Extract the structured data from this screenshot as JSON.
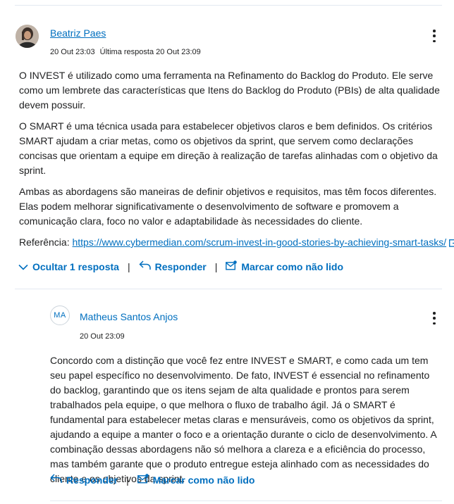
{
  "post": {
    "author": "Beatriz Paes",
    "date": "20 Out 23:03",
    "last_reply": "Última resposta 20 Out 23:09",
    "paragraphs": [
      "O INVEST é utilizado como uma ferramenta na Refinamento do Backlog do Produto. Ele serve como um lembrete das características que Itens do Backlog do Produto (PBIs) de alta qualidade devem possuir.",
      "O SMART é uma técnica usada para estabelecer objetivos claros e bem definidos. Os critérios SMART ajudam a criar metas, como os objetivos da sprint, que servem como declarações concisas que orientam a equipe em direção à realização de tarefas alinhadas com o objetivo da sprint.",
      "Ambas as abordagens são maneiras de definir objetivos e requisitos, mas têm focos diferentes. Elas podem melhorar significativamente o desenvolvimento de software e promovem a comunicação clara, foco no valor e adaptabilidade às necessidades do cliente."
    ],
    "reference_label": "Referência:",
    "reference_url": "https://www.cybermedian.com/scrum-invest-in-good-stories-by-achieving-smart-tasks/",
    "actions": {
      "hide_replies": "Ocultar 1 resposta",
      "reply": "Responder",
      "mark_unread": "Marcar como não lido"
    }
  },
  "reply": {
    "initials": "MA",
    "author": "Matheus Santos Anjos",
    "date": "20 Out 23:09",
    "text": "Concordo com a distinção que você fez entre INVEST e SMART, e como cada um tem seu papel específico no desenvolvimento. De fato, INVEST é essencial no refinamento do backlog, garantindo que os itens sejam de alta qualidade e prontos para serem trabalhados pela equipe, o que melhora o fluxo de trabalho ágil. Já o SMART é fundamental para estabelecer metas claras e mensuráveis, como os objetivos da sprint, ajudando a equipe a manter o foco e a orientação durante o ciclo de desenvolvimento. A combinação dessas abordagens não só melhora a clareza e a eficiência do processo, mas também garante que o produto entregue esteja alinhado com as necessidades do cliente e os objetivos da sprint.",
    "actions": {
      "reply": "Responder",
      "mark_unread": "Marcar como não lido"
    }
  },
  "colors": {
    "link": "#006fbf",
    "text": "#202122",
    "divider": "#e3e9f1"
  }
}
